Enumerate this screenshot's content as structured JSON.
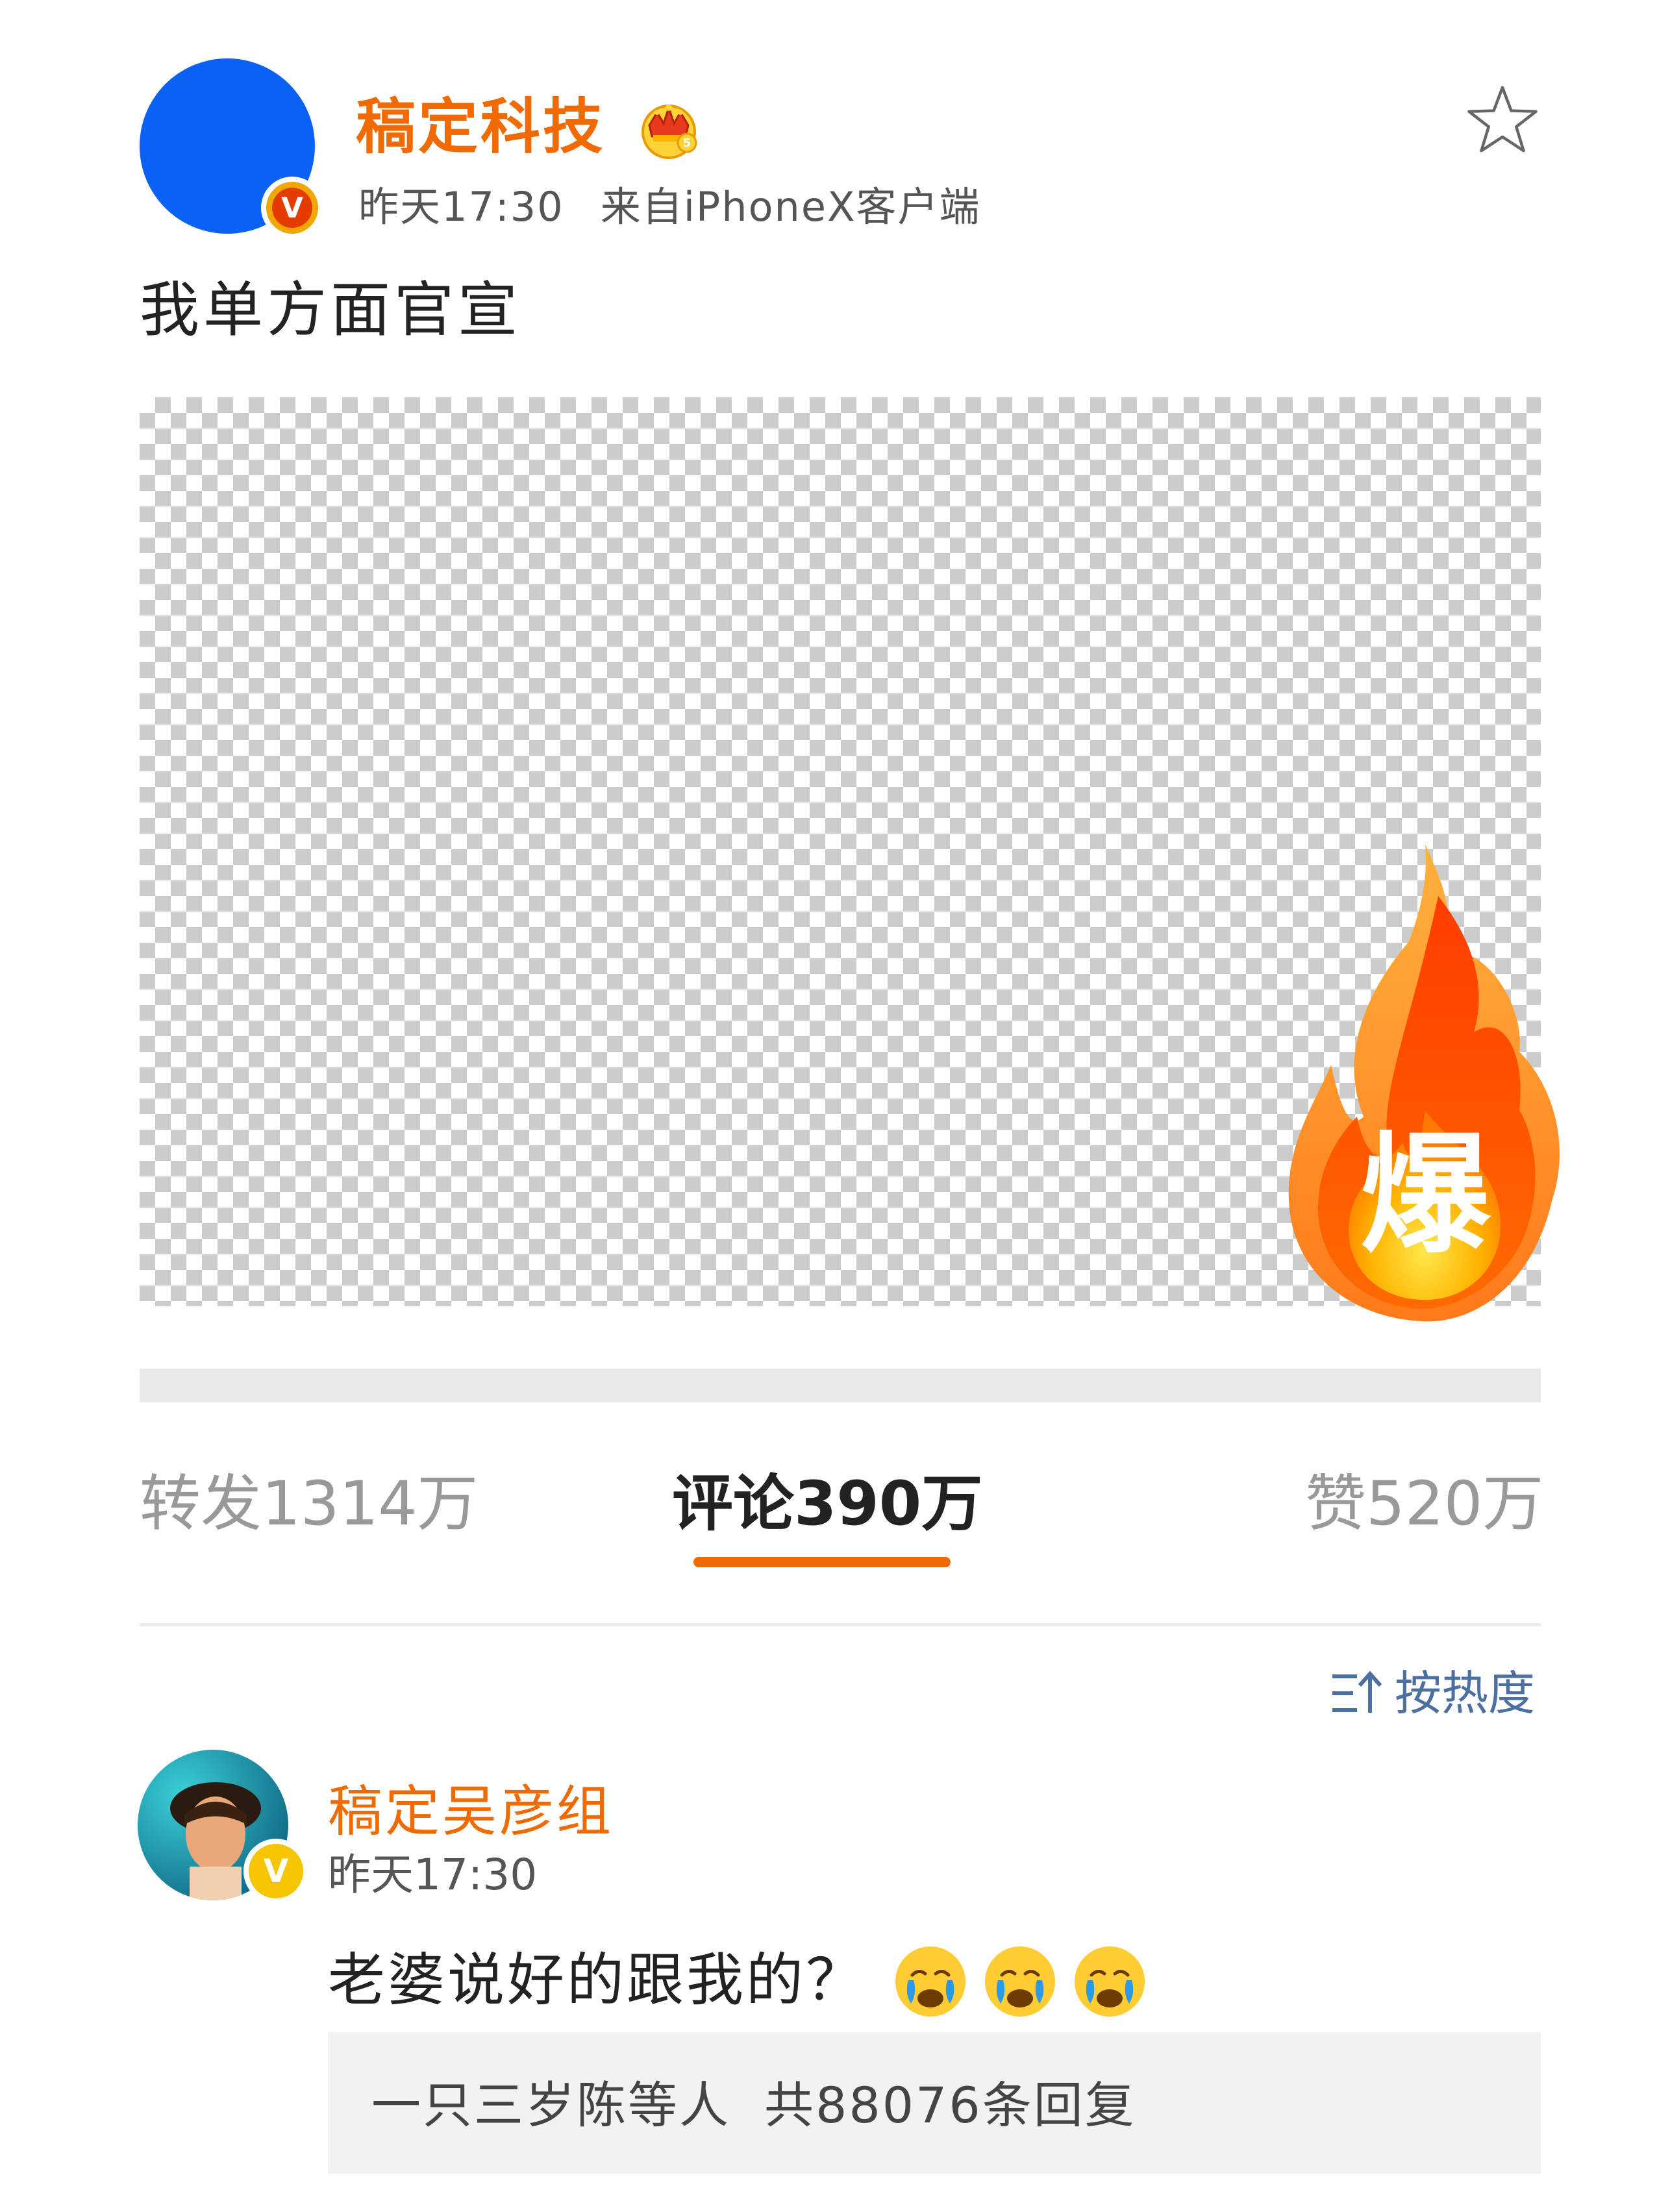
{
  "post": {
    "author": "稿定科技",
    "time": "昨天17:30",
    "source": "来自iPhoneX客户端",
    "text": "我单方面官宣",
    "verified_badge": "V",
    "image_badge": "爆"
  },
  "tabs": {
    "repost": "转发1314万",
    "comments": "评论390万",
    "likes": "赞520万",
    "active": "comments"
  },
  "sort": {
    "label": "按热度"
  },
  "comment": {
    "author": "稿定吴彦组",
    "time": "昨天17:30",
    "text": "老婆说好的跟我的？",
    "verified_badge": "V",
    "emojis": [
      "crying-face",
      "crying-face",
      "crying-face"
    ],
    "reply_summary": {
      "users": "一只三岁陈等人",
      "count": "共88076条回复"
    }
  },
  "colors": {
    "accent": "#f06a00",
    "avatar": "#0a62f5",
    "sort_link": "#4a6fa0"
  }
}
